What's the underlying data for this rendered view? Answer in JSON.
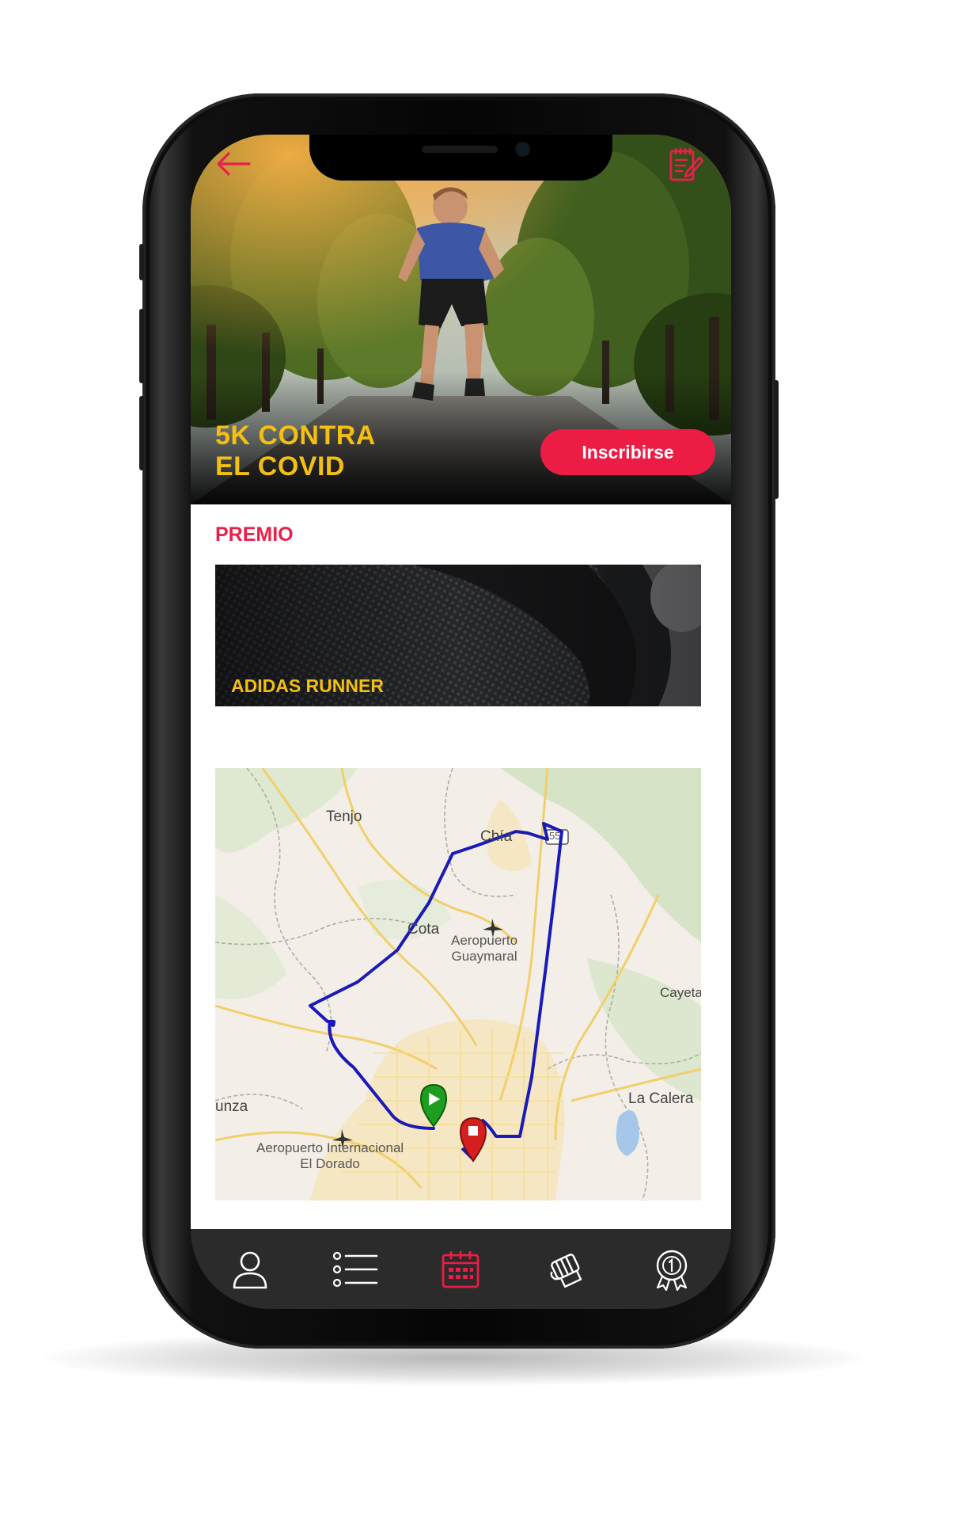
{
  "event": {
    "title": "5K CONTRA\nEL COVID",
    "enroll_label": "Inscribirse"
  },
  "header": {
    "back_icon": "arrow-left-icon",
    "action_icon": "clipboard-edit-icon"
  },
  "prize": {
    "section_title": "PREMIO",
    "name": "ADIDAS RUNNER"
  },
  "map": {
    "labels": {
      "tenjo": "Tenjo",
      "chia": "Chía",
      "route55": "55",
      "cota": "Cota",
      "guaymaral": "Aeropuerto\nGuaymaral",
      "cayeta": "Cayeta",
      "funza": "unza",
      "la_calera": "La Calera",
      "eldorado": "Aeropuerto Internacional\nEl Dorado"
    },
    "markers": [
      "start-marker",
      "end-marker"
    ]
  },
  "tabbar": {
    "items": [
      {
        "icon": "user-icon"
      },
      {
        "icon": "list-icon"
      },
      {
        "icon": "calendar-icon",
        "active": true
      },
      {
        "icon": "fist-icon"
      },
      {
        "icon": "medal-icon"
      }
    ]
  },
  "colors": {
    "accent": "#ec1c45",
    "title_yellow": "#f2bf12",
    "route_blue": "#1a1ab8",
    "tabbar_bg": "#2b2b2b"
  }
}
